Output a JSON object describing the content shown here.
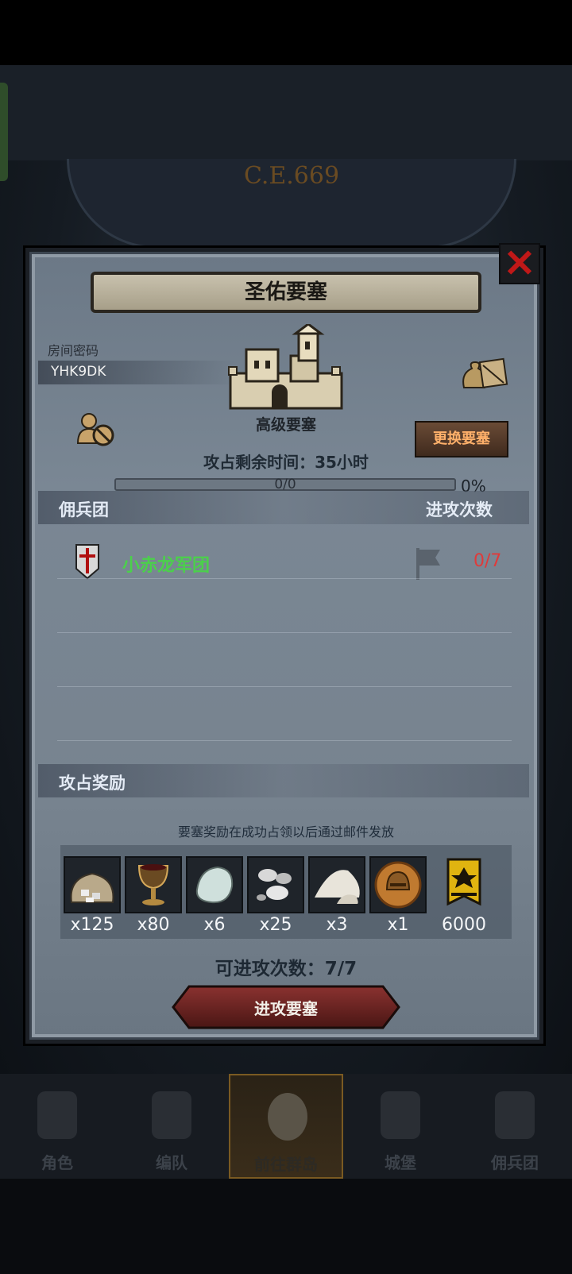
{
  "background": {
    "date": "C.E.669"
  },
  "dialog": {
    "title": "圣佑要塞",
    "close_glyph": "✕",
    "room_label": "房间密码",
    "room_code": "YHK9DK",
    "fortress_type": "高级要塞",
    "change_button": "更换要塞",
    "remaining_time": "攻占剩余时间：35小时",
    "progress": {
      "text": "0/0",
      "percent_label": "0%",
      "value": 0
    }
  },
  "mercenary_section": {
    "title": "佣兵团",
    "right_title": "进攻次数",
    "rows": [
      {
        "name": "小赤龙军团",
        "attacks": "0/7"
      }
    ]
  },
  "reward_section": {
    "title": "攻占奖励",
    "note": "要塞奖励在成功占领以后通过邮件发放",
    "items": [
      {
        "icon": "stone-sack-icon",
        "qty": "x125"
      },
      {
        "icon": "goblet-icon",
        "qty": "x80"
      },
      {
        "icon": "gem-icon",
        "qty": "x6"
      },
      {
        "icon": "silver-ore-icon",
        "qty": "x25"
      },
      {
        "icon": "salt-pile-icon",
        "qty": "x3"
      },
      {
        "icon": "helmet-medal-icon",
        "qty": "x1"
      },
      {
        "icon": "banner-emblem-icon",
        "qty": "6000"
      }
    ]
  },
  "attack_available": "可进攻次数：7/7",
  "attack_button": "进攻要塞",
  "bottom_nav": [
    {
      "label": "角色",
      "active": false
    },
    {
      "label": "编队",
      "active": false
    },
    {
      "label": "前往群岛",
      "active": true
    },
    {
      "label": "城堡",
      "active": false
    },
    {
      "label": "佣兵团",
      "active": false
    }
  ],
  "colors": {
    "accent_orange": "#ffb06a",
    "guild_green": "#4bd04b",
    "attack_red": "#e03a3a",
    "close_red": "#c01818"
  }
}
